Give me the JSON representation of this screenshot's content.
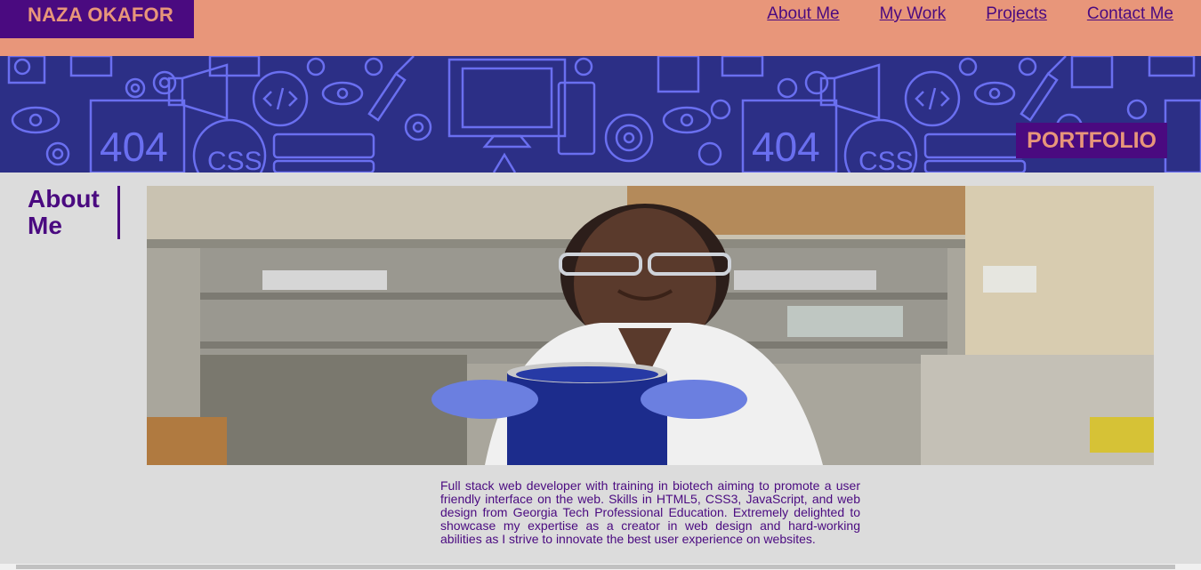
{
  "header": {
    "logo": "NAZA OKAFOR",
    "nav": [
      "About Me",
      "My Work",
      "Projects",
      "Contact Me"
    ]
  },
  "hero": {
    "badge": "PORTFOLIO",
    "pattern_texts": [
      "404",
      "CSS",
      "404",
      "CSS"
    ]
  },
  "about": {
    "heading_line1": "About",
    "heading_line2": "Me",
    "description": "Full stack web developer with training in biotech aiming to promote a user friendly interface on the web. Skills in HTML5, CSS3, JavaScript, and web design from Georgia Tech Professional Education. Extremely delighted to showcase my expertise as a creator in web design and hard-working abilities as I strive to innovate the best user experience on websites."
  },
  "colors": {
    "header_bg": "#e8967a",
    "accent_purple": "#4a0a80",
    "hero_bg": "#2c2f86",
    "hero_pattern": "#6a6ff0",
    "page_bg": "#dcdcdc"
  }
}
